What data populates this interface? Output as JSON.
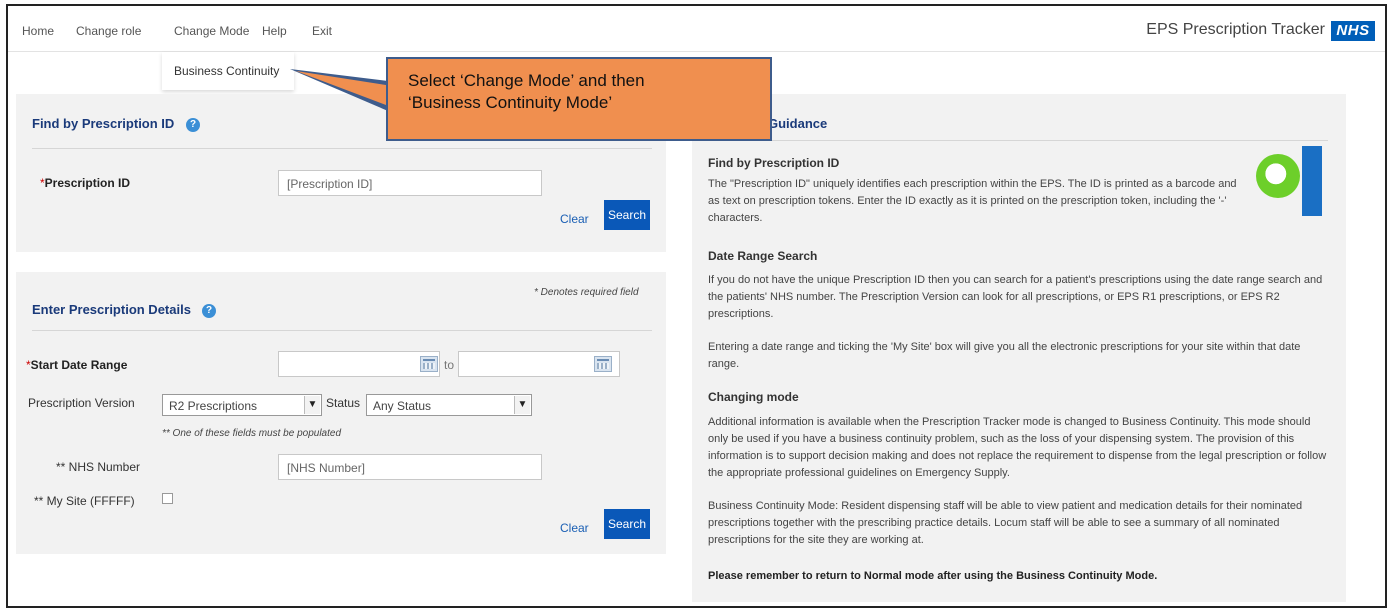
{
  "nav": {
    "items": [
      "Home",
      "Change role",
      "Change Mode",
      "Help",
      "Exit"
    ],
    "app_title": "EPS Prescription Tracker",
    "logo": "NHS",
    "dropdown_item": "Business Continuity"
  },
  "callout": {
    "line1": "Select ‘Change Mode’ and then",
    "line2": "‘Business Continuity Mode’"
  },
  "find": {
    "title": "Find by Prescription ID",
    "required_mark": "*",
    "label": "Prescription ID",
    "placeholder": "[Prescription ID]",
    "clear": "Clear",
    "search": "Search"
  },
  "details": {
    "title": "Enter Prescription Details",
    "required_note": "* Denotes required field",
    "start_date_mark": "*",
    "start_date_label": "Start Date Range",
    "to": "to",
    "version_label": "Prescription Version",
    "version_value": "R2 Prescriptions",
    "status_label": "Status",
    "status_value": "Any Status",
    "one_field_note": "** One of these fields must be populated",
    "nhs_label": "** NHS Number",
    "nhs_placeholder": "[NHS Number]",
    "mysite_label": "** My Site (FFFFF)",
    "clear": "Clear",
    "search": "Search"
  },
  "guidance": {
    "title": "Guidance",
    "h1": "Find by Prescription ID",
    "p1": "The \"Prescription ID\" uniquely identifies each prescription within the EPS. The ID is printed as a barcode and as text on prescription tokens. Enter the ID exactly as it is printed on the prescription token, including the '-' characters.",
    "h2": "Date Range Search",
    "p2": "If you do not have the unique Prescription ID then you can search for a patient's prescriptions using the date range search and the patients' NHS number. The Prescription Version can look for all prescriptions, or EPS R1 prescriptions, or EPS R2 prescriptions.",
    "p3": "Entering a date range and ticking the 'My Site' box will give you all the electronic prescriptions for your site within that date range.",
    "h3": "Changing mode",
    "p4": "Additional information is available when the Prescription Tracker mode is changed to Business Continuity. This mode should only be used if you have a business continuity problem, such as the loss of your dispensing system. The provision of this information is to support decision making and does not replace the requirement to dispense from the legal prescription or follow the appropriate professional guidelines on Emergency Supply.",
    "p5": "Business Continuity Mode: Resident dispensing staff will be able to view patient and medication details for their nominated prescriptions together with the prescribing practice details. Locum staff will be able to see a summary of all nominated prescriptions for the site they are working at.",
    "p6": "Please remember to return to Normal mode after using the Business Continuity Mode."
  }
}
